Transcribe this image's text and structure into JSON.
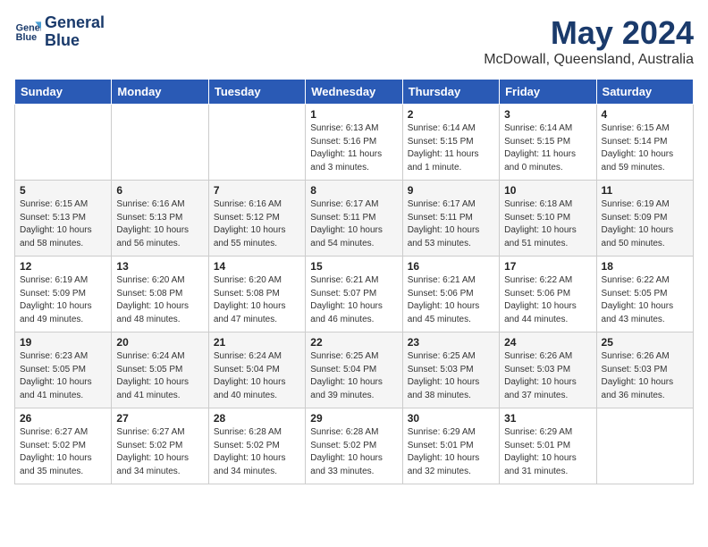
{
  "header": {
    "logo_line1": "General",
    "logo_line2": "Blue",
    "month": "May 2024",
    "location": "McDowall, Queensland, Australia"
  },
  "weekdays": [
    "Sunday",
    "Monday",
    "Tuesday",
    "Wednesday",
    "Thursday",
    "Friday",
    "Saturday"
  ],
  "weeks": [
    [
      {
        "day": "",
        "content": ""
      },
      {
        "day": "",
        "content": ""
      },
      {
        "day": "",
        "content": ""
      },
      {
        "day": "1",
        "content": "Sunrise: 6:13 AM\nSunset: 5:16 PM\nDaylight: 11 hours\nand 3 minutes."
      },
      {
        "day": "2",
        "content": "Sunrise: 6:14 AM\nSunset: 5:15 PM\nDaylight: 11 hours\nand 1 minute."
      },
      {
        "day": "3",
        "content": "Sunrise: 6:14 AM\nSunset: 5:15 PM\nDaylight: 11 hours\nand 0 minutes."
      },
      {
        "day": "4",
        "content": "Sunrise: 6:15 AM\nSunset: 5:14 PM\nDaylight: 10 hours\nand 59 minutes."
      }
    ],
    [
      {
        "day": "5",
        "content": "Sunrise: 6:15 AM\nSunset: 5:13 PM\nDaylight: 10 hours\nand 58 minutes."
      },
      {
        "day": "6",
        "content": "Sunrise: 6:16 AM\nSunset: 5:13 PM\nDaylight: 10 hours\nand 56 minutes."
      },
      {
        "day": "7",
        "content": "Sunrise: 6:16 AM\nSunset: 5:12 PM\nDaylight: 10 hours\nand 55 minutes."
      },
      {
        "day": "8",
        "content": "Sunrise: 6:17 AM\nSunset: 5:11 PM\nDaylight: 10 hours\nand 54 minutes."
      },
      {
        "day": "9",
        "content": "Sunrise: 6:17 AM\nSunset: 5:11 PM\nDaylight: 10 hours\nand 53 minutes."
      },
      {
        "day": "10",
        "content": "Sunrise: 6:18 AM\nSunset: 5:10 PM\nDaylight: 10 hours\nand 51 minutes."
      },
      {
        "day": "11",
        "content": "Sunrise: 6:19 AM\nSunset: 5:09 PM\nDaylight: 10 hours\nand 50 minutes."
      }
    ],
    [
      {
        "day": "12",
        "content": "Sunrise: 6:19 AM\nSunset: 5:09 PM\nDaylight: 10 hours\nand 49 minutes."
      },
      {
        "day": "13",
        "content": "Sunrise: 6:20 AM\nSunset: 5:08 PM\nDaylight: 10 hours\nand 48 minutes."
      },
      {
        "day": "14",
        "content": "Sunrise: 6:20 AM\nSunset: 5:08 PM\nDaylight: 10 hours\nand 47 minutes."
      },
      {
        "day": "15",
        "content": "Sunrise: 6:21 AM\nSunset: 5:07 PM\nDaylight: 10 hours\nand 46 minutes."
      },
      {
        "day": "16",
        "content": "Sunrise: 6:21 AM\nSunset: 5:06 PM\nDaylight: 10 hours\nand 45 minutes."
      },
      {
        "day": "17",
        "content": "Sunrise: 6:22 AM\nSunset: 5:06 PM\nDaylight: 10 hours\nand 44 minutes."
      },
      {
        "day": "18",
        "content": "Sunrise: 6:22 AM\nSunset: 5:05 PM\nDaylight: 10 hours\nand 43 minutes."
      }
    ],
    [
      {
        "day": "19",
        "content": "Sunrise: 6:23 AM\nSunset: 5:05 PM\nDaylight: 10 hours\nand 41 minutes."
      },
      {
        "day": "20",
        "content": "Sunrise: 6:24 AM\nSunset: 5:05 PM\nDaylight: 10 hours\nand 41 minutes."
      },
      {
        "day": "21",
        "content": "Sunrise: 6:24 AM\nSunset: 5:04 PM\nDaylight: 10 hours\nand 40 minutes."
      },
      {
        "day": "22",
        "content": "Sunrise: 6:25 AM\nSunset: 5:04 PM\nDaylight: 10 hours\nand 39 minutes."
      },
      {
        "day": "23",
        "content": "Sunrise: 6:25 AM\nSunset: 5:03 PM\nDaylight: 10 hours\nand 38 minutes."
      },
      {
        "day": "24",
        "content": "Sunrise: 6:26 AM\nSunset: 5:03 PM\nDaylight: 10 hours\nand 37 minutes."
      },
      {
        "day": "25",
        "content": "Sunrise: 6:26 AM\nSunset: 5:03 PM\nDaylight: 10 hours\nand 36 minutes."
      }
    ],
    [
      {
        "day": "26",
        "content": "Sunrise: 6:27 AM\nSunset: 5:02 PM\nDaylight: 10 hours\nand 35 minutes."
      },
      {
        "day": "27",
        "content": "Sunrise: 6:27 AM\nSunset: 5:02 PM\nDaylight: 10 hours\nand 34 minutes."
      },
      {
        "day": "28",
        "content": "Sunrise: 6:28 AM\nSunset: 5:02 PM\nDaylight: 10 hours\nand 34 minutes."
      },
      {
        "day": "29",
        "content": "Sunrise: 6:28 AM\nSunset: 5:02 PM\nDaylight: 10 hours\nand 33 minutes."
      },
      {
        "day": "30",
        "content": "Sunrise: 6:29 AM\nSunset: 5:01 PM\nDaylight: 10 hours\nand 32 minutes."
      },
      {
        "day": "31",
        "content": "Sunrise: 6:29 AM\nSunset: 5:01 PM\nDaylight: 10 hours\nand 31 minutes."
      },
      {
        "day": "",
        "content": ""
      }
    ]
  ]
}
